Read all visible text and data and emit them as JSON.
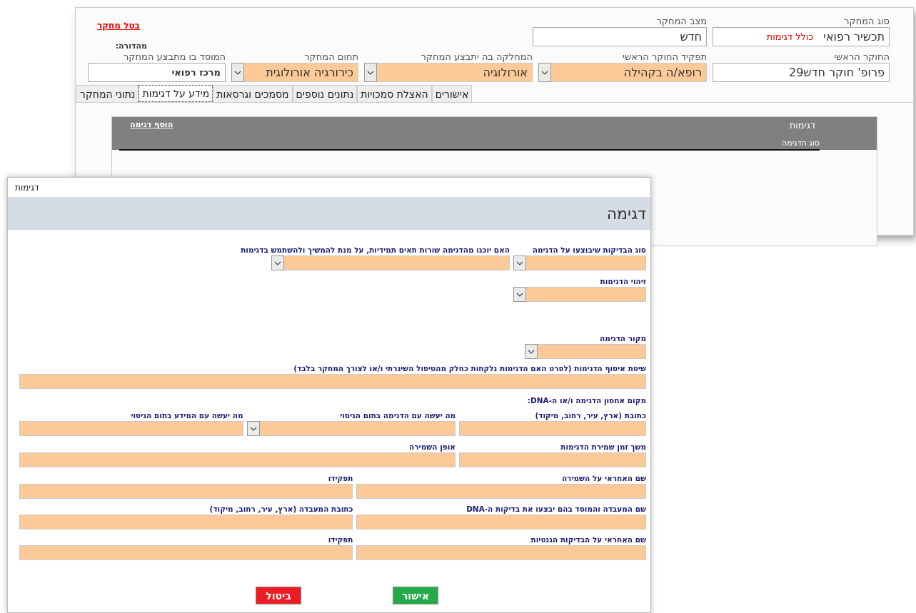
{
  "back_window": {
    "cancel_link": "בטל מחקר",
    "edition_label": "מהדורה:",
    "top_fields": [
      {
        "label": "סוג המחקר",
        "value": "תכשיר רפואי",
        "note": "כולל דגימות",
        "kind": "text"
      },
      {
        "label": "מצב המחקר",
        "value": "חדש",
        "kind": "text"
      }
    ],
    "fields": [
      {
        "label": "החוקר הראשי",
        "value": "פרופ' חוקר חדש29",
        "kind": "text"
      },
      {
        "label": "תפקיד החוקר הראשי",
        "value": "רופא/ה בקהילה",
        "kind": "dropdown"
      },
      {
        "label": "המחלקה בה יתבצע המחקר",
        "value": "אורולוגיה",
        "kind": "dropdown"
      },
      {
        "label": "תחום המחקר",
        "value": "כירורגיה אורולוגית",
        "kind": "dropdown"
      },
      {
        "label": "המוסד בו מתבצע המחקר",
        "value": "מרכז רפואי",
        "kind": "text",
        "bold": true
      }
    ],
    "tabs": [
      {
        "label": "אישורים",
        "selected": false
      },
      {
        "label": "האצלת סמכויות",
        "selected": false
      },
      {
        "label": "נתונים נוספים",
        "selected": false
      },
      {
        "label": "מסמכים וגרסאות",
        "selected": false
      },
      {
        "label": "מידע על דגימות",
        "selected": true
      },
      {
        "label": "נתוני המחקר",
        "selected": false
      }
    ],
    "samples_panel": {
      "title": "דגימות",
      "add_link": "הוסף דגימה",
      "columns": [
        "סוג הדגימה"
      ]
    }
  },
  "dialog": {
    "title": "דגימות",
    "heading": "דגימה",
    "rows": [
      {
        "kind": "fields",
        "fields": [
          {
            "label": "סוג הבדיקות שיבוצעו על הדגימה",
            "kind": "dropdown"
          },
          {
            "label": "האם יוכנו מהדגימה שורות תאים תמידיות, על מנת להמשיך ולהשתמש בדגימות",
            "kind": "dropdown"
          }
        ]
      },
      {
        "kind": "fields",
        "fields": [
          {
            "label": "זיהוי הדגימות",
            "kind": "dropdown"
          }
        ]
      },
      {
        "kind": "fields",
        "fields": [
          {
            "label": "מקור הדגימה",
            "kind": "dropdown"
          }
        ]
      },
      {
        "kind": "fields",
        "fields": [
          {
            "label": "שיטת איסוף הדגימות (לפרט האם הדגימות נלקחות כחלק מהטיפול השיגרתי ו/או לצורך המחקר בלבד)",
            "kind": "text"
          }
        ]
      },
      {
        "kind": "heading",
        "text": "מקום אחסון הדגימה ו/או ה-DNA:"
      },
      {
        "kind": "fields",
        "fields": [
          {
            "label": "כתובת (ארץ, עיר, רחוב, מיקוד)",
            "kind": "text"
          },
          {
            "label": "מה יעשה עם הדגימה בתום הניסוי",
            "kind": "dropdown"
          },
          {
            "label": "מה יעשה עם המידע בתום הניסוי",
            "kind": "text"
          }
        ]
      },
      {
        "kind": "fields",
        "fields": [
          {
            "label": "משך זמן שמירת הדגימות",
            "kind": "text"
          },
          {
            "label": "אופן השמירה",
            "kind": "text"
          }
        ]
      },
      {
        "kind": "fields",
        "fields": [
          {
            "label": "שם האחראי על השמירה",
            "kind": "text"
          },
          {
            "label": "תפקידו",
            "kind": "text"
          }
        ]
      },
      {
        "kind": "fields",
        "fields": [
          {
            "label": "שם המעבדה והמוסד בהם יבצעו את בדיקות ה-DNA",
            "kind": "text"
          },
          {
            "label": "כתובת המעבדה (ארץ, עיר, רחוב, מיקוד)",
            "kind": "text"
          }
        ]
      },
      {
        "kind": "fields",
        "fields": [
          {
            "label": "שם האחראי על הבדיקות הגנטיות",
            "kind": "text"
          },
          {
            "label": "תפקידו",
            "kind": "text"
          }
        ]
      }
    ],
    "buttons": [
      {
        "label": "אישור",
        "kind": "confirm"
      },
      {
        "label": "ביטול",
        "kind": "cancel"
      }
    ]
  }
}
